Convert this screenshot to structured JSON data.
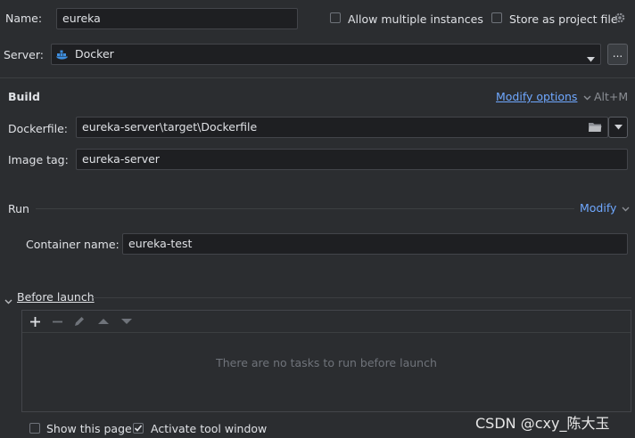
{
  "name": {
    "label": "Name:",
    "value": "eureka"
  },
  "options": {
    "allow_multiple": "Allow multiple instances",
    "store_project": "Store as project file"
  },
  "server": {
    "label": "Server:",
    "value": "Docker",
    "more": "..."
  },
  "build": {
    "heading": "Build",
    "modify": "Modify options",
    "shortcut": "Alt+M",
    "dockerfile_label": "Dockerfile:",
    "dockerfile_value": "eureka-server\\target\\Dockerfile",
    "image_tag_label": "Image tag:",
    "image_tag_value": "eureka-server"
  },
  "run": {
    "heading": "Run",
    "modify": "Modify",
    "container_label": "Container name:",
    "container_value": "eureka-test"
  },
  "before_launch": {
    "heading": "Before launch",
    "empty_text": "There are no tasks to run before launch"
  },
  "footer": {
    "show_page": "Show this page",
    "activate_tool": "Activate tool window"
  },
  "watermark": "CSDN @cxy_陈大玉",
  "colors": {
    "background": "#2b2d30",
    "field": "#1e1f22",
    "link": "#6fa8ff",
    "docker": "#3e8ede"
  }
}
